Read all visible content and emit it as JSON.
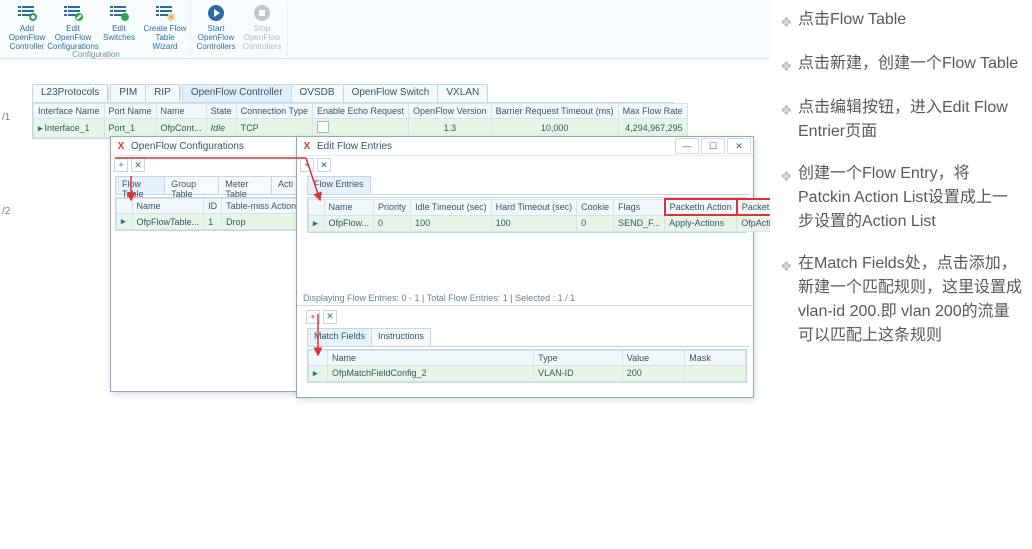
{
  "ribbon": {
    "group1": {
      "buttons": [
        {
          "label": "Add OpenFlow Controller"
        },
        {
          "label": "Edit OpenFlow Configurations"
        },
        {
          "label": "Edit Switches"
        },
        {
          "label": "Create Flow Table Wizard"
        }
      ],
      "title": "Configuration"
    },
    "group2": {
      "buttons": [
        {
          "label": "Start OpenFlow Controllers"
        },
        {
          "label": "Stop OpenFlow Controllers"
        }
      ],
      "title": ""
    }
  },
  "scenario": {
    "s1": "/1",
    "s2": "/2"
  },
  "main_tabs": [
    "L23Protocols",
    "PIM",
    "RIP",
    "OpenFlow Controller",
    "OVSDB",
    "OpenFlow Switch",
    "VXLAN"
  ],
  "main_tabs_selected": 3,
  "main_grid": {
    "headers": [
      "Interface Name",
      "Port Name",
      "Name",
      "State",
      "Connection Type",
      "Enable Echo Request",
      "OpenFlow Version",
      "Barrier Request Timeout (ms)",
      "Max Flow Rate"
    ],
    "row": {
      "iface": "Interface_1",
      "port": "Port_1",
      "name": "OfpCont...",
      "state": "Idle",
      "conn": "TCP",
      "echo": "",
      "ver": "1.3",
      "barrier": "10,000",
      "max": "4,294,967,295"
    }
  },
  "dlg1": {
    "title": "OpenFlow Configurations",
    "tabs": [
      "Flow Table",
      "Group Table",
      "Meter Table",
      "Acti"
    ],
    "tabs_selected": 0,
    "grid": {
      "headers": [
        "Name",
        "ID",
        "Table-miss Action"
      ],
      "row": {
        "name": "OfpFlowTable...",
        "id": "1",
        "miss": "Drop"
      }
    }
  },
  "dlg2": {
    "title": "Edit Flow Entries",
    "tabs": [
      "Flow Entries"
    ],
    "grid": {
      "headers": [
        "Name",
        "Priority",
        "Idle Timeout (sec)",
        "Hard Timeout (sec)",
        "Cookie",
        "Flags",
        "PacketIn Action",
        "PacketIn Action List"
      ],
      "row": {
        "name": "OfpFlow...",
        "prio": "0",
        "idle": "100",
        "hard": "100",
        "cookie": "0",
        "flags": "SEND_F...",
        "paction": "Apply-Actions",
        "plist": "OfpActionListC..."
      }
    },
    "status": "Displaying Flow Entries:  0 - 1 | Total Flow Entries: 1 | Selected : 1 / 1",
    "btabs": [
      "Match Fields",
      "Instructions"
    ],
    "btabs_selected": 0,
    "bgrid": {
      "headers": [
        "Name",
        "Type",
        "Value",
        "Mask"
      ],
      "row": {
        "name": "OfpMatchFieldConfig_2",
        "type": "VLAN-ID",
        "value": "200",
        "mask": ""
      }
    }
  },
  "notes": [
    "点击Flow Table",
    "点击新建，创建一个Flow Table",
    "点击编辑按钮，进入Edit Flow Entrier页面",
    "创建一个Flow  Entry，将Patckin Action List设置成上一步设置的Action List",
    "在Match Fields处，点击添加，新建一个匹配规则，这里设置成vlan-id 200.即 vlan 200的流量可以匹配上这条规则"
  ],
  "colors": {
    "accent": "#2c6aa0",
    "red": "#d33",
    "tabsel": "#e0effa"
  }
}
